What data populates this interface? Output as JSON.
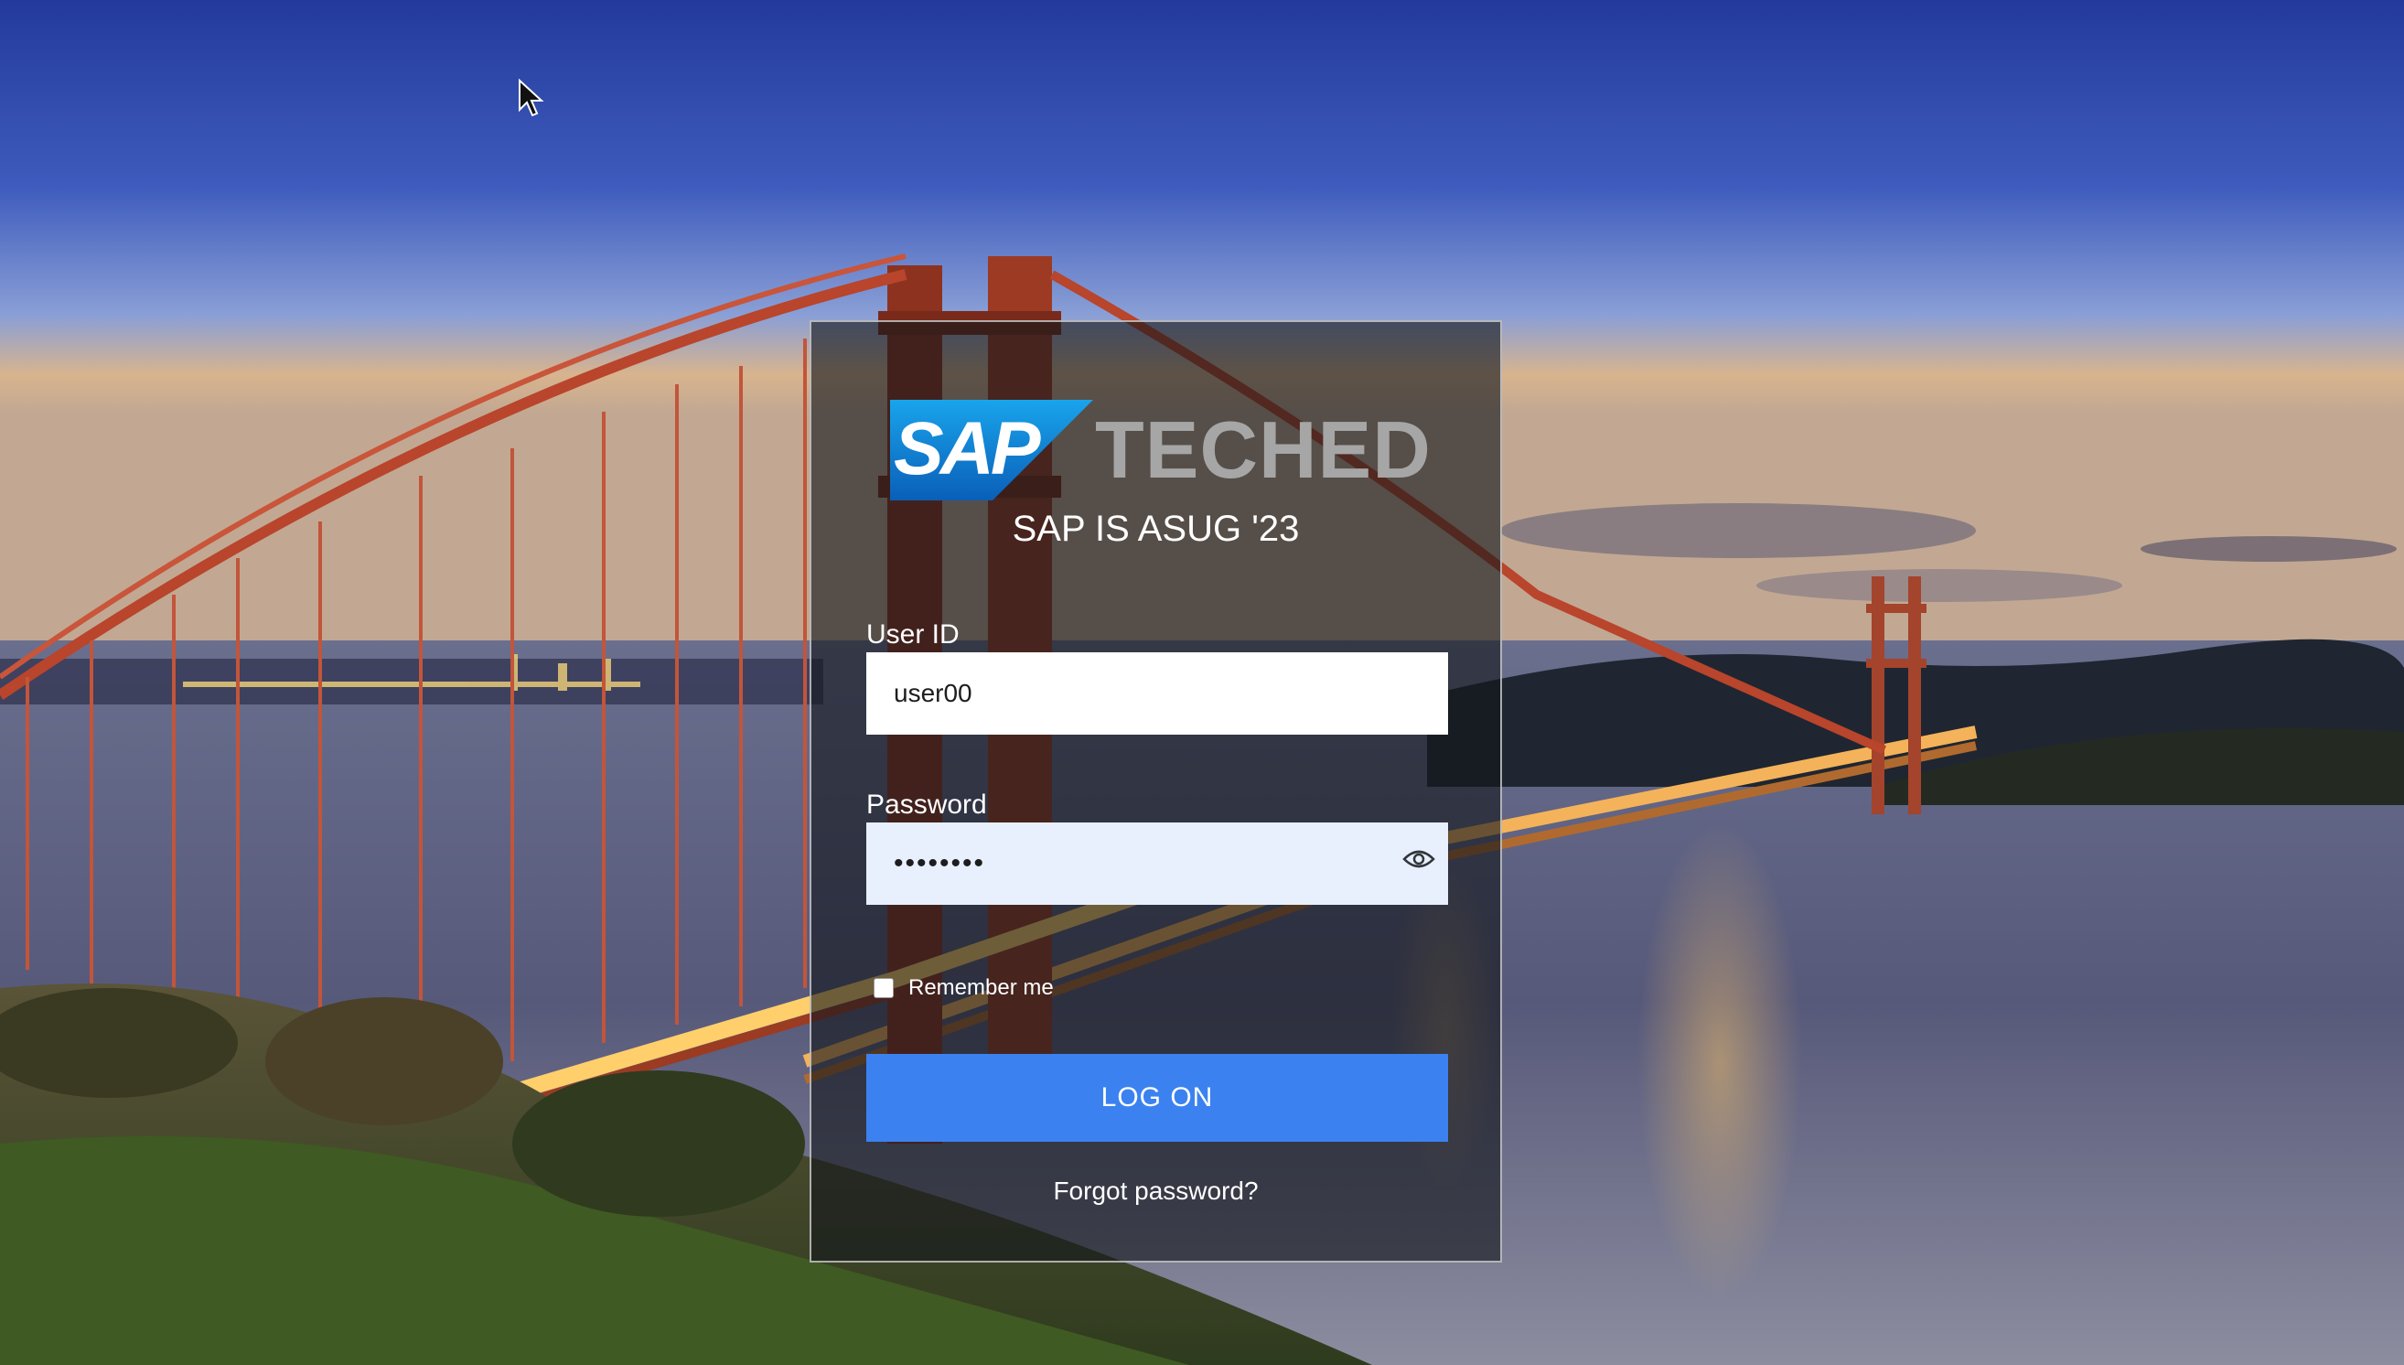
{
  "logo": {
    "brand": "SAP",
    "event": "TECHED",
    "brand_color": "#0a6ed1",
    "event_color": "#a6a6a6"
  },
  "subtitle": "SAP IS ASUG '23",
  "form": {
    "user_id_label": "User ID",
    "user_id_value": "user00",
    "password_label": "Password",
    "password_value": "••••••••",
    "password_toggle_icon": "eye-icon",
    "remember_label": "Remember me",
    "remember_checked": false,
    "logon_label": "LOG ON",
    "forgot_label": "Forgot password?"
  },
  "colors": {
    "button": "#3b82f0",
    "password_field_bg": "#e8f0fe"
  }
}
